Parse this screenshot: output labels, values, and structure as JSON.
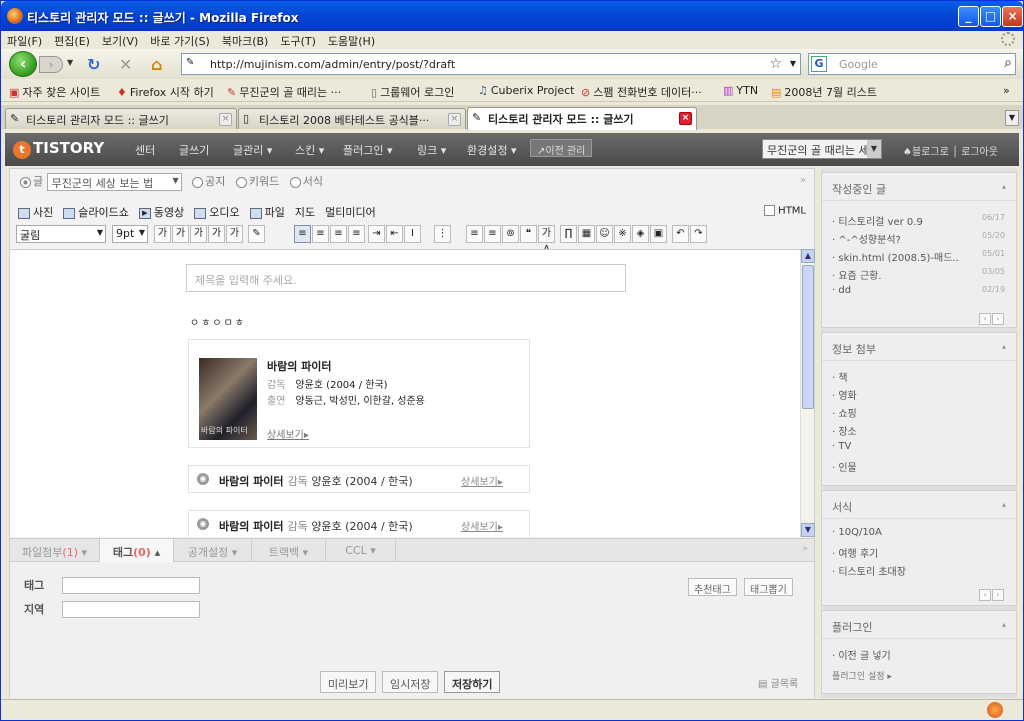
{
  "window": {
    "title": "티스토리 관리자 모드 :: 글쓰기 - Mozilla Firefox",
    "buttons": [
      "_",
      "□",
      "×"
    ]
  },
  "menu": [
    "파일(F)",
    "편집(E)",
    "보기(V)",
    "바로 가기(S)",
    "북마크(B)",
    "도구(T)",
    "도움말(H)"
  ],
  "nav": {
    "url": "http://mujinism.com/admin/entry/post/?draft",
    "search_placeholder": "Google"
  },
  "bookmarks": [
    "자주 찾은 사이트",
    "Firefox 시작 하기",
    "무진군의 골 때리는 ···",
    "그룹웨어 로그인",
    "Cuberix Project",
    "스팸 전화번호 데이터···",
    "YTN",
    "2008년 7월 리스트"
  ],
  "bookmarks_more": "»",
  "tabs": [
    {
      "label": "티스토리 관리자 모드 :: 글쓰기",
      "active": false
    },
    {
      "label": "티스토리 2008 베타테스트 공식블···",
      "active": false
    },
    {
      "label": "티스토리 관리자 모드 :: 글쓰기",
      "active": true
    }
  ],
  "tistory": {
    "logo": "TISTORY",
    "logo_mark": "t",
    "nav": [
      "센터",
      "글쓰기",
      "글관리 ▾",
      "스킨 ▾",
      "플러그인 ▾",
      "링크 ▾",
      "환경설정 ▾"
    ],
    "prev": "↗이전 관리",
    "blog": "무진군의 골 때리는 세.",
    "links": "♠블로그로 │ 로그아웃"
  },
  "editor": {
    "types": [
      "글",
      "공지",
      "키워드",
      "서식"
    ],
    "category": "무진군의 세상 보는 법",
    "collapse": "»",
    "insert": [
      "사진",
      "슬라이드쇼",
      "동영상",
      "오디오",
      "파일",
      "지도",
      "멀티미디어"
    ],
    "html_label": "HTML",
    "font": "굴림",
    "size": "9pt",
    "format_buttons": [
      "가",
      "가",
      "가",
      "가",
      "가",
      "✎",
      "≡",
      "≡",
      "≡",
      "≡",
      "⇥",
      "⇤",
      "I",
      "⋮",
      "≡",
      "≡",
      "⊚",
      "❝",
      "가A",
      "∏",
      "▦",
      "☺",
      "※",
      "◈",
      "▣",
      "↶",
      "↷"
    ],
    "title_placeholder": "제목을 입력해 주세요.",
    "body_text": "ㅇㅎㅇㅁㅎ",
    "movie": {
      "title": "바람의 파이터",
      "poster_text": "바람의 파이터",
      "director_label": "감독",
      "director": "양윤호 (2004 / 한국)",
      "cast_label": "출연",
      "cast": "양동근, 박성민, 이한갈, 성준용",
      "more": "상세보기"
    },
    "lines": [
      {
        "title": "바람의 파이터",
        "label": "감독",
        "director": "양윤호 (2004 / 한국)",
        "more": "상세보기"
      },
      {
        "title": "바람의 파이터",
        "label": "감독",
        "director": "양윤호 (2004 / 한국)",
        "more": "상세보기"
      }
    ],
    "bottom_tabs": [
      {
        "label": "파일첨부",
        "count": "(1)",
        "suffix": " ▾"
      },
      {
        "label": "태그",
        "count": "(0)",
        "suffix": " ▴"
      },
      {
        "label": "공개설정 ▾",
        "count": "",
        "suffix": ""
      },
      {
        "label": "트랙백 ▾",
        "count": "",
        "suffix": ""
      },
      {
        "label": "CCL ▾",
        "count": "",
        "suffix": ""
      }
    ],
    "bottom_collapse": "»",
    "tag_label": "태그",
    "location_label": "지역",
    "recommend_tag": "추천태그",
    "tag_pick": "태그뽑기",
    "preview": "미리보기",
    "save_draft": "임시저장",
    "save": "저장하기",
    "list": "글목록"
  },
  "sidebar": {
    "drafts": {
      "title": "작성중인 글",
      "items": [
        {
          "t": "티스토리걸 ver 0.9",
          "d": "06/17"
        },
        {
          "t": "^-^성향분석?",
          "d": "05/20"
        },
        {
          "t": "skin.html (2008.5)-매드..",
          "d": "05/01"
        },
        {
          "t": "요즘 근황.",
          "d": "03/05"
        },
        {
          "t": "dd",
          "d": "02/19"
        }
      ]
    },
    "info": {
      "title": "정보 첨부",
      "items": [
        "책",
        "영화",
        "쇼핑",
        "장소",
        "TV",
        "인물"
      ]
    },
    "forms": {
      "title": "서식",
      "items": [
        "10Q/10A",
        "여행 후기",
        "티스토리 초대장"
      ]
    },
    "plugin": {
      "title": "플러그인",
      "items": [
        "이전 글 넣기"
      ],
      "link": "플러그인 설정 ▸"
    },
    "collapse_mark": "▴",
    "pager": [
      "‹",
      "›"
    ]
  }
}
